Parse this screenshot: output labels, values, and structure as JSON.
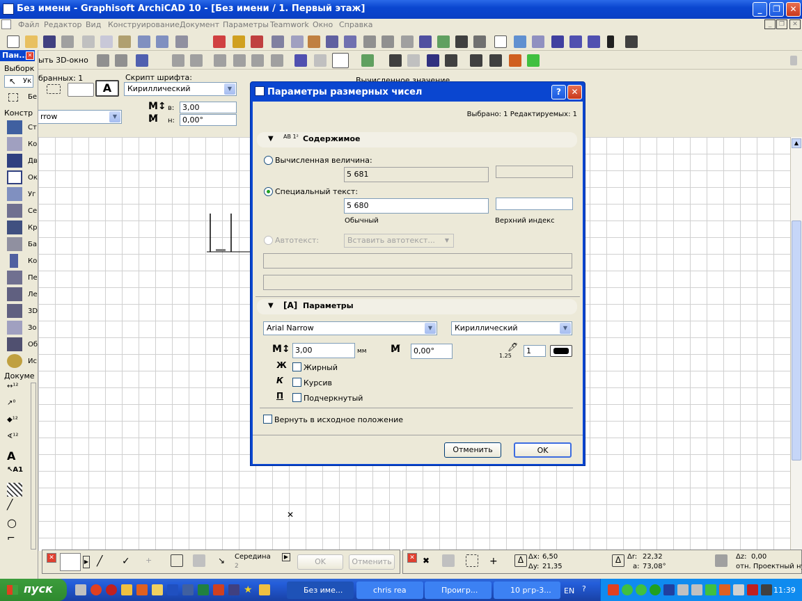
{
  "window": {
    "title": "Без имени - Graphisoft ArchiCAD 10 - [Без имени / 1. Первый этаж]"
  },
  "menu": [
    "Файл",
    "Редактор",
    "Вид",
    "Конструирование",
    "Документ",
    "Параметры",
    "Teamwork",
    "Окно",
    "Справка"
  ],
  "toolbar3": {
    "show3d": "ыть 3D-окно"
  },
  "toolbox": {
    "title": "Пан...",
    "select_section": "Выборк",
    "select_item": "Ук",
    "select_item2": "Бе",
    "construct_section": "Констр",
    "construct_items": [
      "Ст",
      "Ко",
      "Дв",
      "Ок",
      "Уг",
      "Се",
      "Кр",
      "Ба",
      "Ко",
      "Пе",
      "Ле",
      "3D",
      "Зо",
      "Об",
      "Ис"
    ],
    "document_section": "Докуме"
  },
  "infobox": {
    "selected": "бранных: 1",
    "script_label": "Скрипт шрифта:",
    "script_value": "Кириллический",
    "font_value": "rrow",
    "height_label": "в:",
    "height_value": "3,00",
    "angle_label": "н:",
    "angle_value": "0,00°",
    "calc_value_label": "Вычисленное значение"
  },
  "dialog": {
    "title": "Параметры размерных чисел",
    "selection_info": "Выбрано: 1 Редактируемых: 1",
    "content_header": "Содержимое",
    "content_icon_text": "AB 1²",
    "calc_label": "Вычисленная величина:",
    "calc_value": "5 681",
    "custom_label": "Специальный текст:",
    "custom_value": "5 680",
    "normal_label": "Обычный",
    "superscript_label": "Верхний индекс",
    "autotext_label": "Автотекст:",
    "autotext_placeholder": "Вставить автотекст...",
    "params_header": "Параметры",
    "font": "Arial Narrow",
    "script": "Кириллический",
    "size": "3,00",
    "size_unit": "мм",
    "angle": "0,00°",
    "pen": "1",
    "pen_size": "1.25",
    "bold_glyph": "Ж",
    "italic_glyph": "К",
    "underline_glyph": "П",
    "bold": "Жирный",
    "italic": "Курсив",
    "underline": "Подчеркнутый",
    "reset": "Вернуть в исходное положение",
    "cancel": "Отменить",
    "ok": "OK"
  },
  "bottom": {
    "midpoint": "Середина",
    "midpoint_sub": "2",
    "ok": "OK",
    "cancel": "Отменить",
    "dx_label": "Δx:",
    "dx": "6,50",
    "dy_label": "Δy:",
    "dy": "21,35",
    "dr_label": "Δr:",
    "dr": "22,32",
    "a_label": "a:",
    "a": "73,08°",
    "dz_label": "Δz:",
    "dz": "0,00",
    "ref": "отн. Проектный ну"
  },
  "taskbar": {
    "start": "пуск",
    "tasks": [
      "Без име...",
      "chris rea",
      "Проигр...",
      "10 ргр-3..."
    ],
    "lang": "EN",
    "clock": "11:39"
  },
  "colors": {
    "titlebar": "#0a46d0",
    "panel": "#ece9d8",
    "taskbar": "#245edb"
  }
}
